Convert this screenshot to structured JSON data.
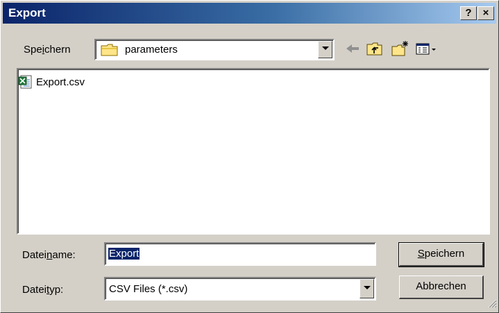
{
  "window": {
    "title": "Export",
    "help_button": "?",
    "close_button": "×"
  },
  "toolbar": {
    "save_in_label_pre": "Spe",
    "save_in_label_accel": "i",
    "save_in_label_post": "chern",
    "current_folder": "parameters",
    "icons": [
      "back-arrow-icon",
      "up-folder-icon",
      "new-folder-icon",
      "view-menu-icon"
    ]
  },
  "file_list": {
    "items": [
      {
        "name": "Export.csv",
        "icon": "excel-csv-file-icon"
      }
    ]
  },
  "filename": {
    "label_pre": "Datei",
    "label_accel": "n",
    "label_post": "ame:",
    "value": "Export"
  },
  "filetype": {
    "label_pre": "Datei",
    "label_accel": "t",
    "label_post": "yp:",
    "value": "CSV Files (*.csv)"
  },
  "buttons": {
    "save_accel": "S",
    "save_rest": "peichern",
    "cancel": "Abbrechen"
  },
  "colors": {
    "title_gradient_start": "#0a246a",
    "title_gradient_end": "#a6caf0",
    "dialog_bg": "#d4d0c8",
    "selection": "#0a246a"
  }
}
